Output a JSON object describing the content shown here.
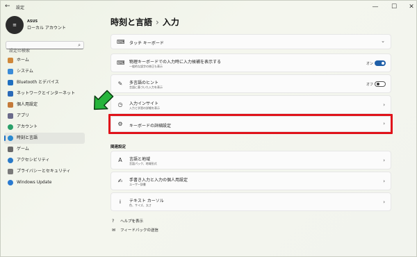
{
  "window": {
    "title": "設定",
    "back_glyph": "←",
    "minimize": "—",
    "maximize": "☐",
    "close": "✕"
  },
  "profile": {
    "name": "ASUS",
    "sub": "ローカル アカウント"
  },
  "search": {
    "placeholder": "設定の検索"
  },
  "nav": [
    {
      "label": "ホーム",
      "icon": "home-icon",
      "color": "#d0883a"
    },
    {
      "label": "システム",
      "icon": "system-icon",
      "color": "#3a8bd8"
    },
    {
      "label": "Bluetooth とデバイス",
      "icon": "bluetooth-icon",
      "color": "#1f6fc0"
    },
    {
      "label": "ネットワークとインターネット",
      "icon": "network-icon",
      "color": "#2a6ab8"
    },
    {
      "label": "個人用設定",
      "icon": "personalization-icon",
      "color": "#c47a3a"
    },
    {
      "label": "アプリ",
      "icon": "apps-icon",
      "color": "#6a6a8a"
    },
    {
      "label": "アカウント",
      "icon": "account-icon",
      "color": "#2aa06a"
    },
    {
      "label": "時刻と言語",
      "icon": "time-language-icon",
      "color": "#2a8ad0",
      "active": true
    },
    {
      "label": "ゲーム",
      "icon": "gaming-icon",
      "color": "#6a6a6a"
    },
    {
      "label": "アクセシビリティ",
      "icon": "accessibility-icon",
      "color": "#2a7ac8"
    },
    {
      "label": "プライバシーとセキュリティ",
      "icon": "privacy-icon",
      "color": "#7a7a7a"
    },
    {
      "label": "Windows Update",
      "icon": "windows-update-icon",
      "color": "#2a7ad0"
    }
  ],
  "header": {
    "parent": "時刻と言語",
    "separator": "›",
    "current": "入力"
  },
  "cards": {
    "touch_keyboard": {
      "title": "タッチ キーボード",
      "icon": "⌨",
      "chevron": "⌄"
    },
    "physical_keyboard": {
      "title": "物理キーボードでの入力時に入力候補を表示する",
      "sub": "一般的な誤字の修正も表示",
      "status": "オン",
      "toggle": "on"
    },
    "multilingual": {
      "title": "多言語のヒント",
      "sub": "言語に基づいた入力を表示",
      "status": "オフ",
      "toggle": "off"
    },
    "input_insights": {
      "title": "入力インサイト",
      "sub": "入力と学習の詳細を表示",
      "chevron": "›"
    },
    "advanced_keyboard": {
      "title": "キーボードの詳細設定",
      "chevron": "›"
    }
  },
  "related": {
    "label": "関連設定",
    "items": [
      {
        "title": "言語と地域",
        "sub": "言語パック、地域形式",
        "icon": "language-region-icon"
      },
      {
        "title": "手書き入力と入力の個人用設定",
        "sub": "ユーザー辞書",
        "icon": "handwriting-icon"
      },
      {
        "title": "テキスト カーソル",
        "sub": "色、サイズ、太さ",
        "icon": "text-cursor-icon"
      }
    ],
    "chevron": "›"
  },
  "links": {
    "help": "ヘルプを表示",
    "feedback": "フィードバックの送信"
  },
  "colors": {
    "highlight": "#e0121a",
    "arrow": "#26b43a",
    "accent": "#1f5fa8"
  }
}
